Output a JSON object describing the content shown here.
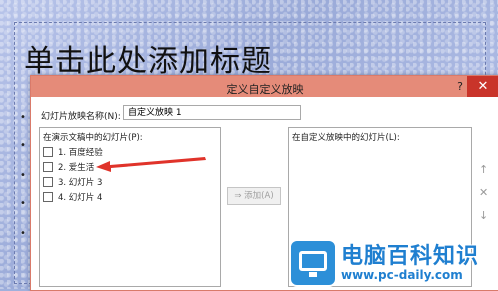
{
  "slide": {
    "title": "单击此处添加标题",
    "bullets": [
      "•",
      "•",
      "•",
      "•",
      "•"
    ]
  },
  "dialog": {
    "title": "定义自定义放映",
    "help_label": "?",
    "close_label": "✕",
    "name_label": "幻灯片放映名称(N):",
    "name_value": "自定义放映 1",
    "left_list_label": "在演示文稿中的幻灯片(P):",
    "right_list_label": "在自定义放映中的幻灯片(L):",
    "add_label": "⇒ 添加(A)",
    "slides": [
      {
        "label": "1. 百度经验",
        "checked": false
      },
      {
        "label": "2. 爱生活",
        "checked": false
      },
      {
        "label": "3. 幻灯片 3",
        "checked": false
      },
      {
        "label": "4. 幻灯片 4",
        "checked": false
      }
    ],
    "side_icons": [
      "arrow-up-icon",
      "remove-x-icon",
      "arrow-down-icon"
    ],
    "side_glyphs": [
      "↑",
      "✕",
      "↓"
    ]
  },
  "annotation": {
    "arrow_color": "#e0332a"
  },
  "watermark": {
    "name": "电脑百科知识",
    "url": "www.pc-daily.com"
  },
  "colors": {
    "titlebar": "#e58b79",
    "close": "#c9342a",
    "brand_blue": "#1f7fd0"
  }
}
